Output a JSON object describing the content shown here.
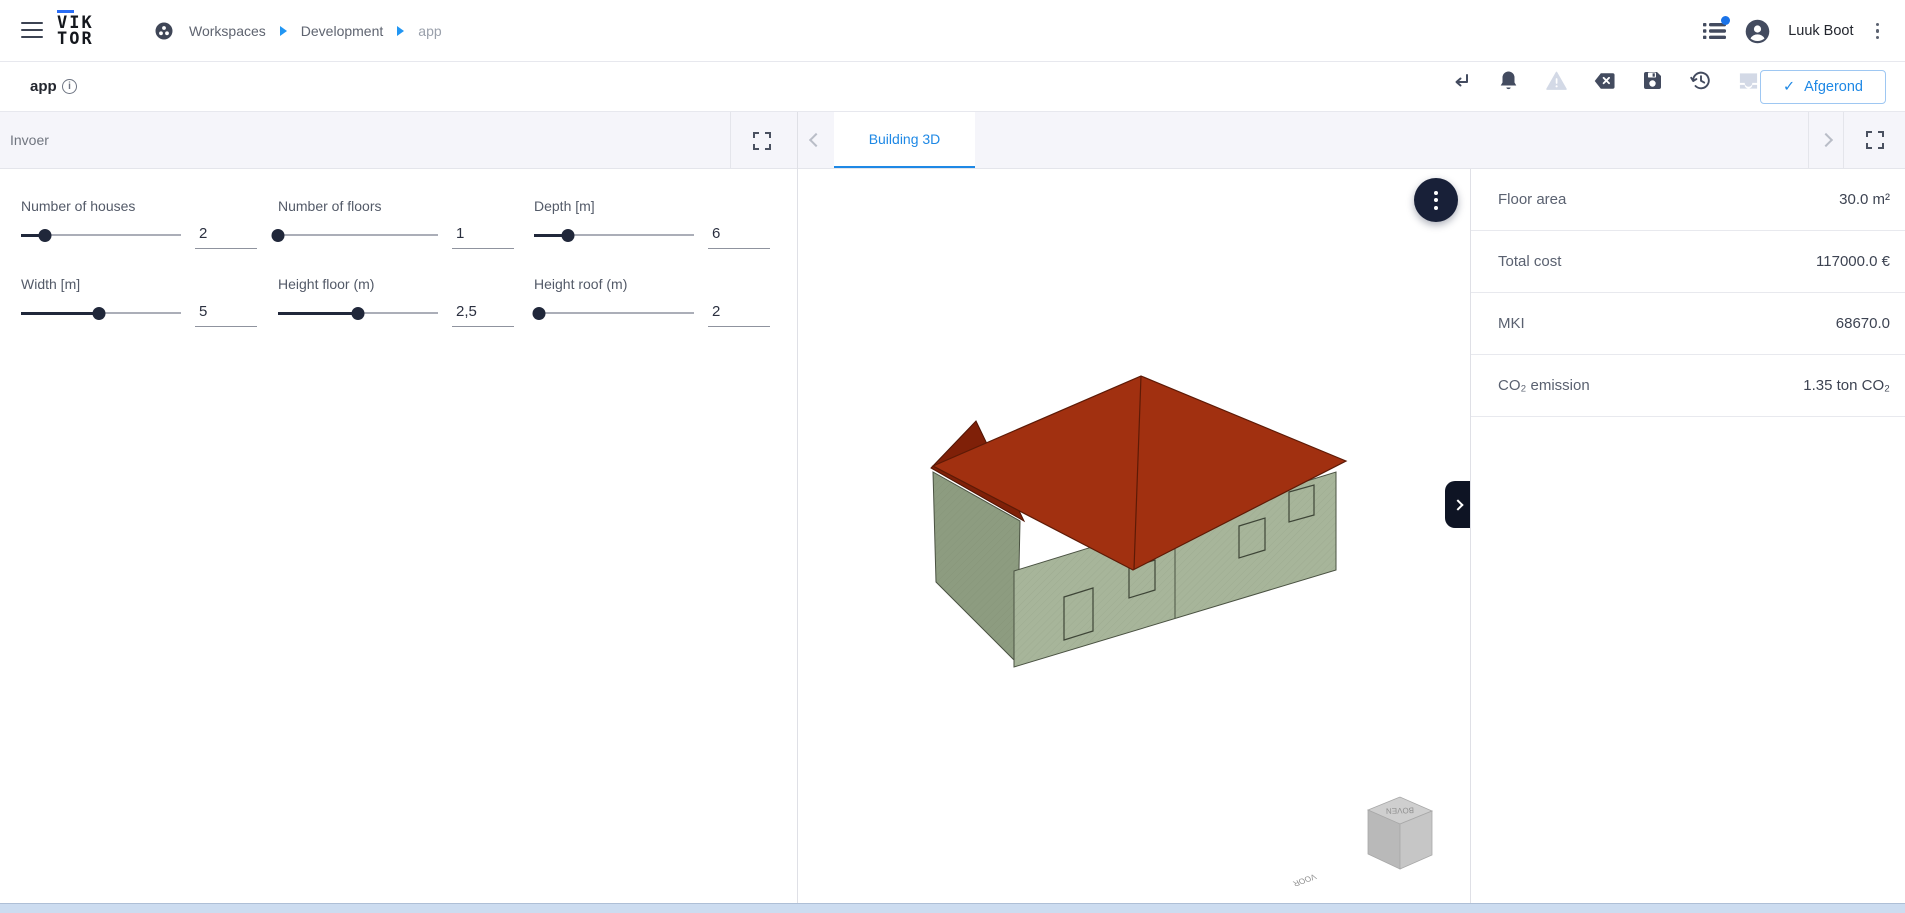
{
  "topbar": {
    "logo_line1": "VIK",
    "logo_line2": "TOR",
    "breadcrumb": [
      {
        "label": "Workspaces",
        "current": false
      },
      {
        "label": "Development",
        "current": false
      },
      {
        "label": "app",
        "current": true
      }
    ],
    "user_name": "Luuk Boot"
  },
  "appbar": {
    "title": "app",
    "toolbar_icons": [
      "return-icon",
      "bell-icon",
      "warning-icon",
      "clear-icon",
      "save-icon",
      "history-icon",
      "tray-icon"
    ],
    "status_button": {
      "label": "Afgerond",
      "check": "✓"
    }
  },
  "left_panel": {
    "header": "Invoer",
    "sliders": [
      {
        "label": "Number of houses",
        "value": "2",
        "percent": 15
      },
      {
        "label": "Number of floors",
        "value": "1",
        "percent": 0
      },
      {
        "label": "Depth [m]",
        "value": "6",
        "percent": 21
      },
      {
        "label": "Width [m]",
        "value": "5",
        "percent": 49
      },
      {
        "label": "Height floor (m)",
        "value": "2,5",
        "percent": 50
      },
      {
        "label": "Height roof (m)",
        "value": "2",
        "percent": 3
      }
    ]
  },
  "tabs": {
    "active": "Building 3D"
  },
  "viewport": {
    "viewcube": {
      "top_label": "BOVEN",
      "front_label": "VOOR"
    }
  },
  "results": [
    {
      "label": "Floor area",
      "value": "30.0 m²"
    },
    {
      "label": "Total cost",
      "value": "117000.0 €"
    },
    {
      "label": "MKI",
      "value": "68670.0"
    },
    {
      "label": "CO₂ emission",
      "value": "1.35 ton CO₂"
    }
  ],
  "colors": {
    "accent_blue": "#1e88e5",
    "breadcrumb_arrow_blue": "#2196f3",
    "notification_blue": "#1a73e8",
    "icon_dark": "#434b5f",
    "icon_disabled": "#d3d9e6",
    "panel_header_bg": "#f5f5fa",
    "slider_dark": "#20273a",
    "fab_bg": "#182038",
    "roof_red": "#a13010",
    "roof_dark": "#7f2008",
    "wall_green": "#a7b59a",
    "wall_green_dark": "#8d9c80",
    "scrollbar_bottom": "#ccdcf0"
  }
}
